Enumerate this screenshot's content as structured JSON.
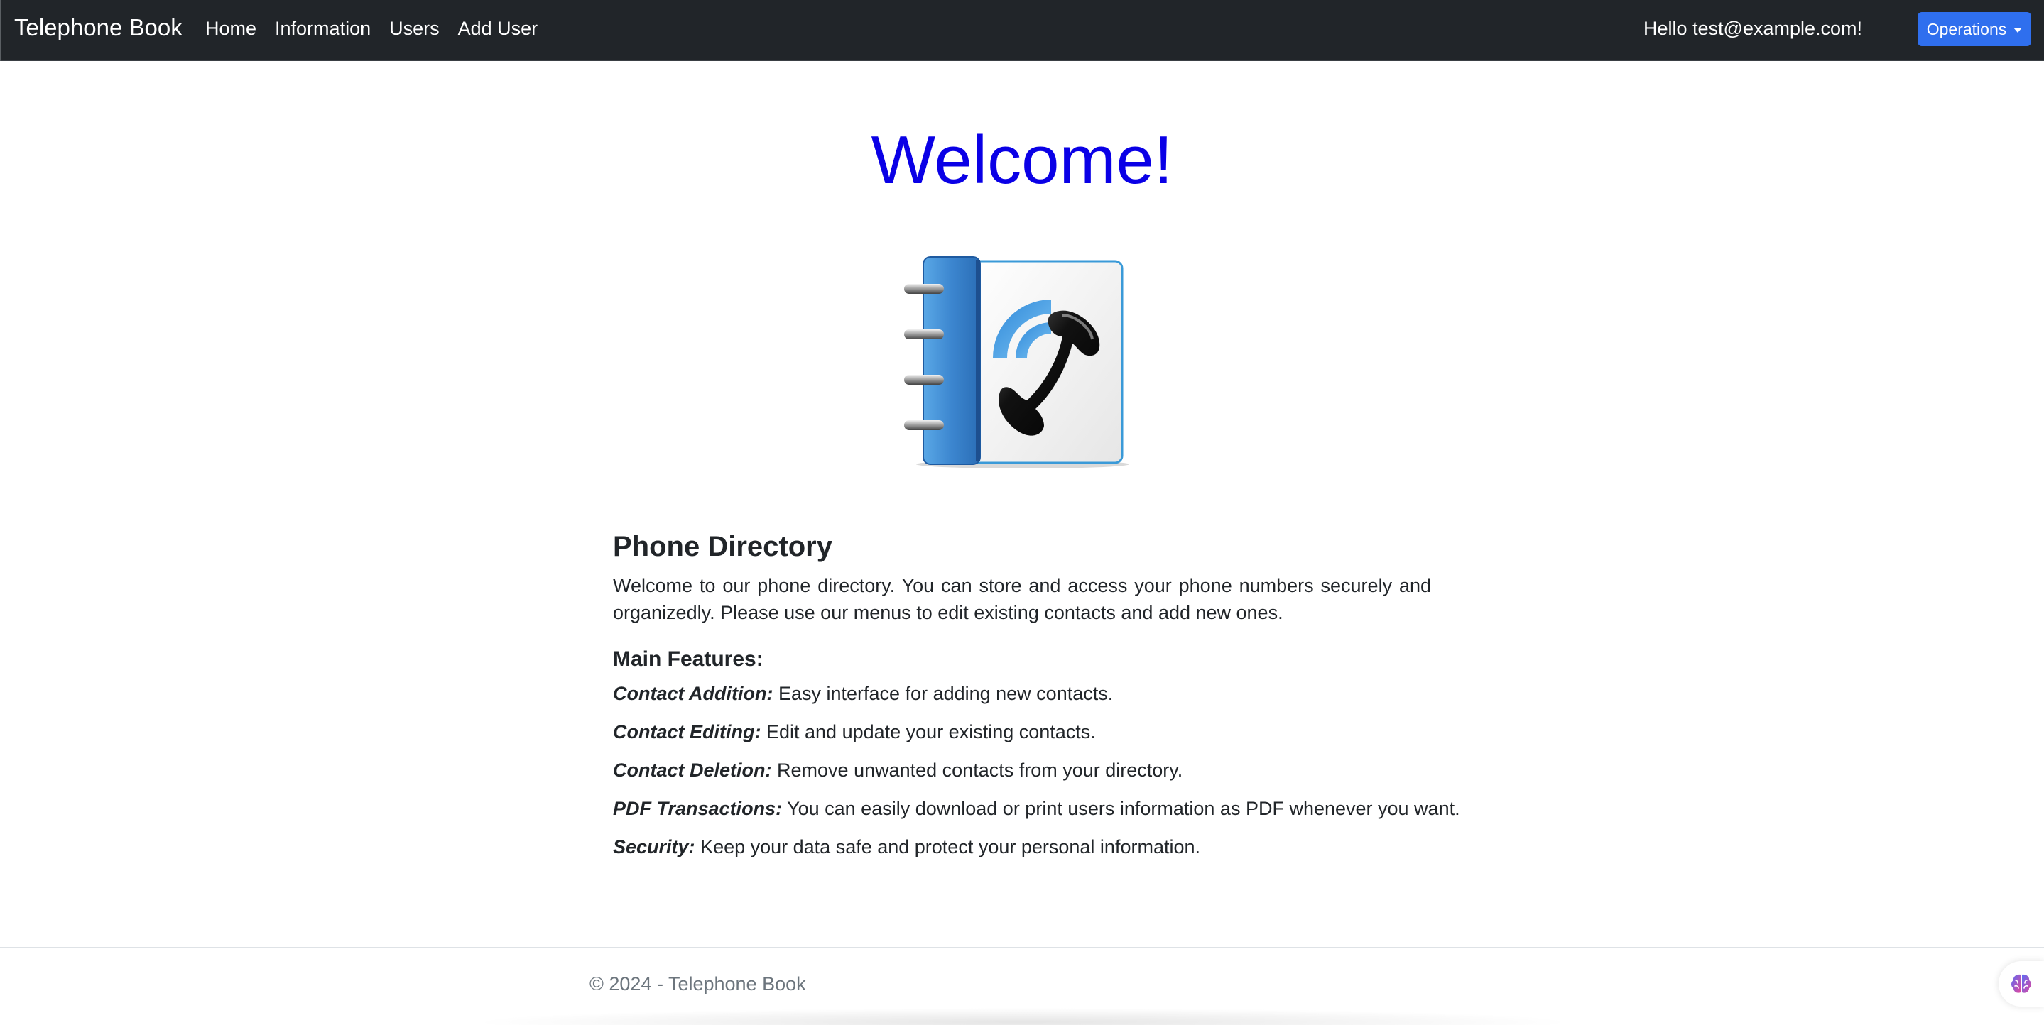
{
  "navbar": {
    "brand": "Telephone Book",
    "links": [
      "Home",
      "Information",
      "Users",
      "Add User"
    ],
    "greeting": "Hello test@example.com!",
    "operations_label": "Operations"
  },
  "main": {
    "welcome": "Welcome!",
    "logo_icon": "phone-book-icon",
    "title": "Phone Directory",
    "intro": "Welcome to our phone directory. You can store and access your phone numbers securely and organizedly. Please use our menus to edit existing contacts and add new ones.",
    "features_title": "Main Features:",
    "features": [
      {
        "name": "Contact Addition:",
        "text": "Easy interface for adding new contacts."
      },
      {
        "name": "Contact Editing:",
        "text": "Edit and update your existing contacts."
      },
      {
        "name": "Contact Deletion:",
        "text": "Remove unwanted contacts from your directory."
      },
      {
        "name": "PDF Transactions:",
        "text": "You can easily download or print users information as PDF whenever you want."
      },
      {
        "name": "Security:",
        "text": "Keep your data safe and protect your personal information."
      }
    ]
  },
  "footer": {
    "copyright": "© 2024 - Telephone Book"
  },
  "colors": {
    "navbar_bg": "#212529",
    "welcome": "#0a00e6",
    "operations_button": "#2f6fee"
  },
  "assistant_icon": "brain-icon"
}
